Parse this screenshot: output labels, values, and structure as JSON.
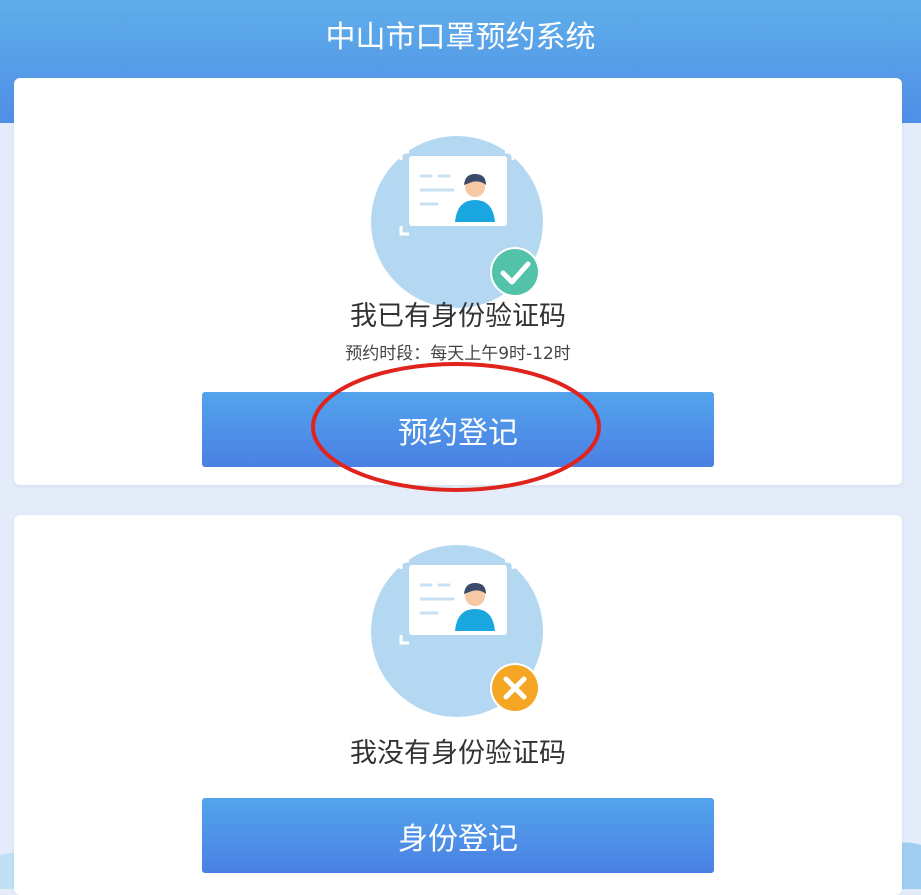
{
  "header": {
    "title": "中山市口罩预约系统"
  },
  "cards": [
    {
      "title": "我已有身份验证码",
      "subtitle": "预约时段：每天上午9时-12时",
      "button_label": "预约登记",
      "status_icon": "check-circle-icon",
      "status_color": "#52c3a9"
    },
    {
      "title": "我没有身份验证码",
      "button_label": "身份登记",
      "status_icon": "close-circle-icon",
      "status_color": "#f5a623"
    }
  ],
  "colors": {
    "header": "#4f8ee6",
    "button": "#4a8ce8",
    "annotation": "#e0231c"
  }
}
